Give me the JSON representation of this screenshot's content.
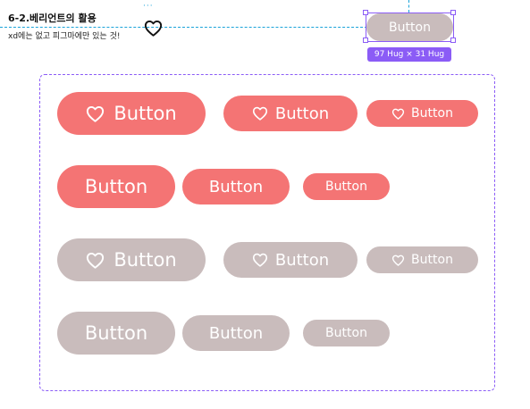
{
  "header": {
    "title": "6-2.베리언트의 활용",
    "subtitle": "xd에는 없고 피그마에만 있는 것!"
  },
  "selected_component": {
    "label": "Button",
    "size_tag": "97 Hug × 31 Hug"
  },
  "colors": {
    "primary": "#f47474",
    "secondary": "#c9bcbc",
    "selection": "#8b5cf6",
    "guide": "#1aa3d9"
  },
  "icons": {
    "heart": "heart-icon"
  },
  "variants": {
    "red_icon": [
      "Button",
      "Button",
      "Button"
    ],
    "red_text": [
      "Button",
      "Button",
      "Button"
    ],
    "gray_icon": [
      "Button",
      "Button",
      "Button"
    ],
    "gray_text": [
      "Button",
      "Button",
      "Button"
    ]
  }
}
